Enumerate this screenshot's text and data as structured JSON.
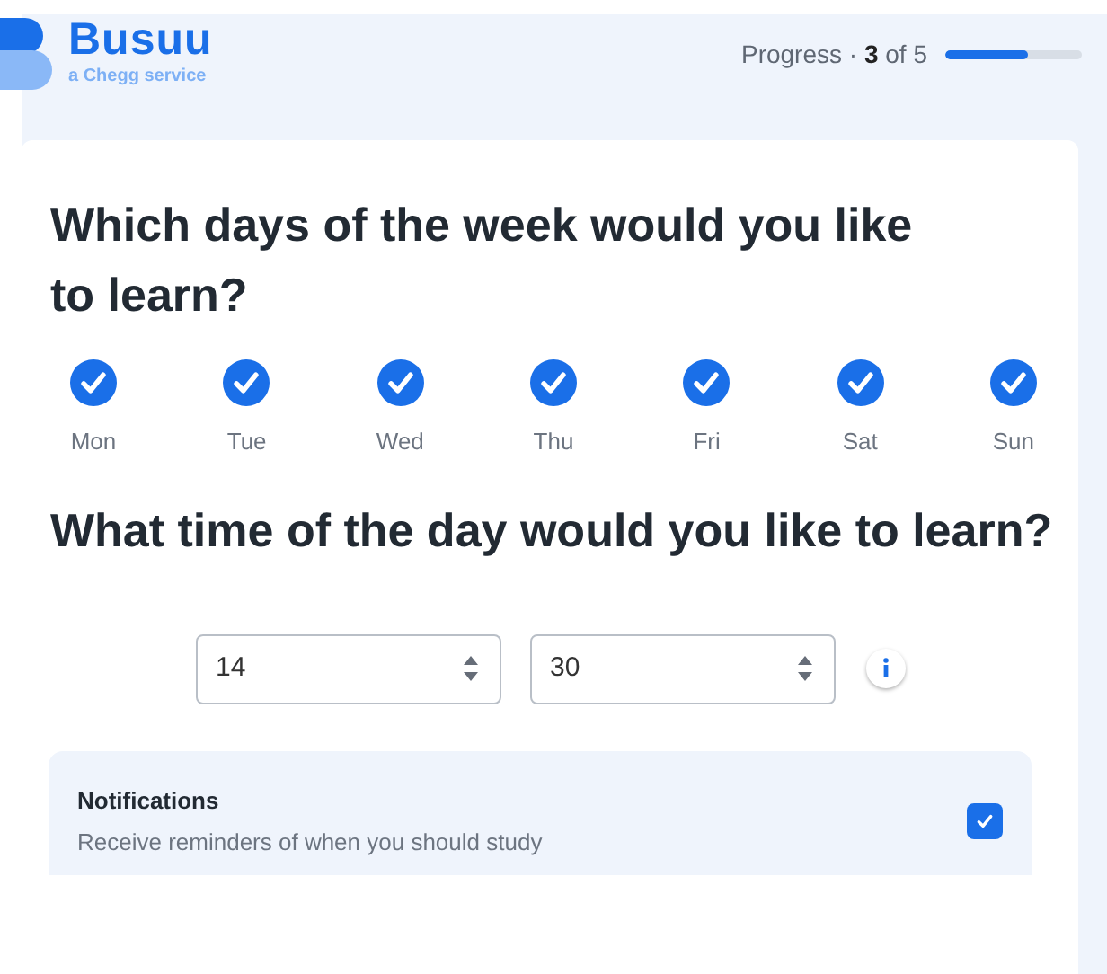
{
  "header": {
    "brand": "Busuu",
    "tagline": "a Chegg service",
    "progress_text": "Progress · **3** of 5",
    "progress": {
      "level": 0.6
    }
  },
  "days_question": "Which days of the week would you like to learn?",
  "days": [
    {
      "label": "Mon",
      "checked": true
    },
    {
      "label": "Tue",
      "checked": true
    },
    {
      "label": "Wed",
      "checked": true
    },
    {
      "label": "Thu",
      "checked": true
    },
    {
      "label": "Fri",
      "checked": true
    },
    {
      "label": "Sat",
      "checked": true
    },
    {
      "label": "Sun",
      "checked": true
    }
  ],
  "time_question": "What time of the day would you like to learn?",
  "time": {
    "hour": "14",
    "minute": "30"
  },
  "notifications": {
    "title": "Notifications",
    "description": "Receive reminders of when you should study",
    "checked": true
  }
}
